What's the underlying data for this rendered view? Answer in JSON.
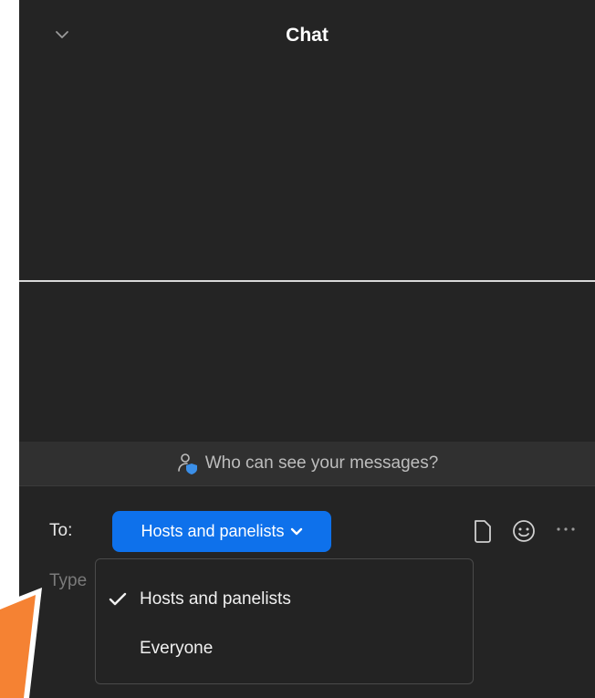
{
  "header": {
    "title": "Chat",
    "collapse_icon": "chevron-down-icon"
  },
  "notice": {
    "text": "Who can see your messages?",
    "icon": "user-shield-icon"
  },
  "composer": {
    "to_label": "To:",
    "recipient_selected": "Hosts and panelists",
    "placeholder_fragment": "Type",
    "tools": [
      "file-icon",
      "emoji-icon",
      "more-icon"
    ]
  },
  "dropdown": {
    "options": [
      {
        "label": "Hosts and panelists",
        "selected": true
      },
      {
        "label": "Everyone",
        "selected": false
      }
    ]
  },
  "colors": {
    "panel_bg": "#242424",
    "accent": "#0e71eb",
    "annotation_orange": "#f58233"
  }
}
